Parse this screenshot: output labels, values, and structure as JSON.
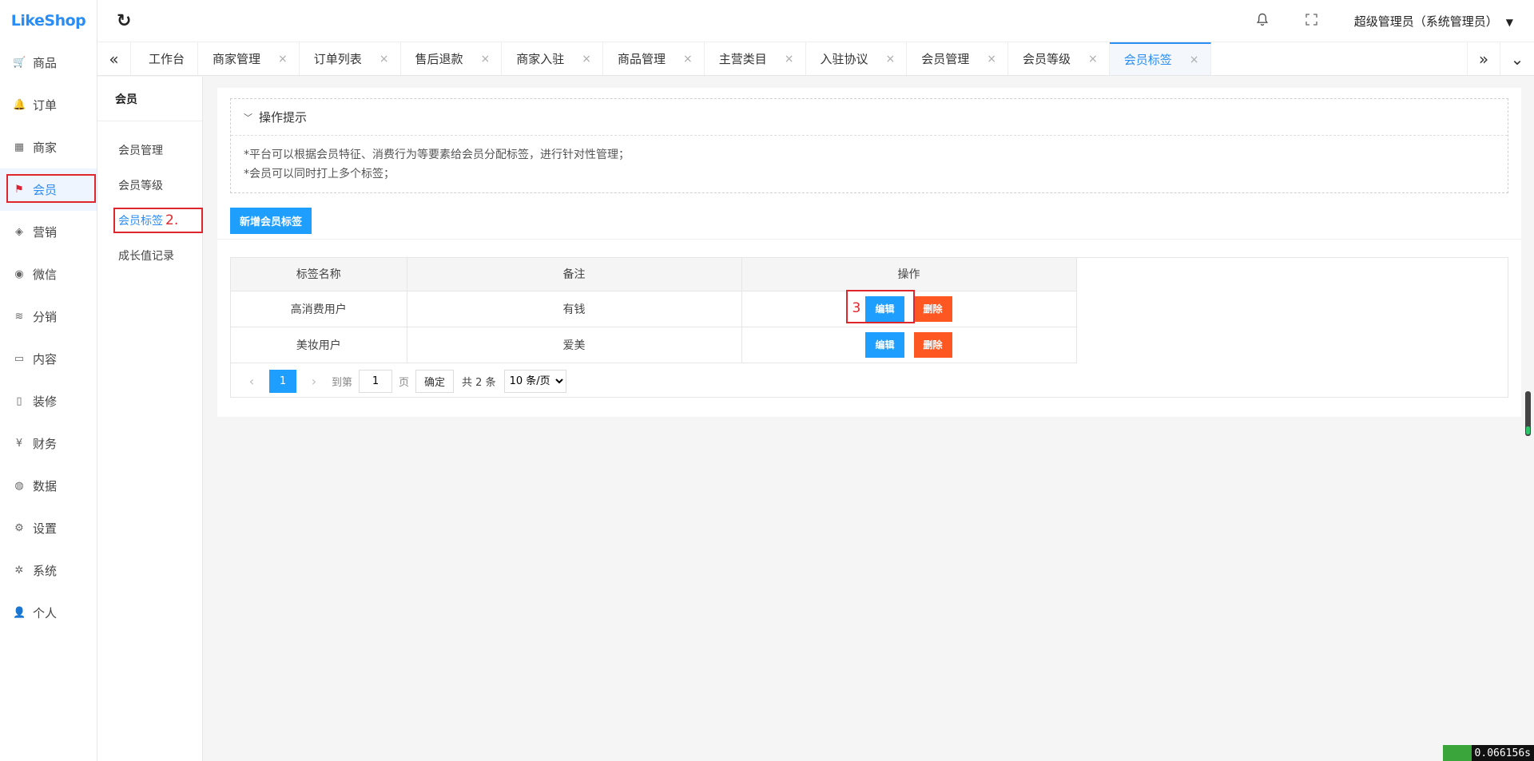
{
  "brand": {
    "logo_text": "LikeShop"
  },
  "header": {
    "refresh_icon": "↻",
    "bell_icon": "bell-icon",
    "fullscreen_icon": "fullscreen-icon",
    "user_name": "超级管理员（系统管理员）"
  },
  "sidebar": {
    "items": [
      {
        "label": "商品",
        "icon": "🛒"
      },
      {
        "label": "订单",
        "icon": "🔔"
      },
      {
        "label": "商家",
        "icon": "▦"
      },
      {
        "label": "会员",
        "icon": "⚑"
      },
      {
        "label": "营销",
        "icon": "◈"
      },
      {
        "label": "微信",
        "icon": "◉"
      },
      {
        "label": "分销",
        "icon": "≋"
      },
      {
        "label": "内容",
        "icon": "▭"
      },
      {
        "label": "装修",
        "icon": "▯"
      },
      {
        "label": "财务",
        "icon": "¥"
      },
      {
        "label": "数据",
        "icon": "◍"
      },
      {
        "label": "设置",
        "icon": "⚙"
      },
      {
        "label": "系统",
        "icon": "✲"
      },
      {
        "label": "个人",
        "icon": "👤"
      }
    ]
  },
  "tabs": [
    {
      "label": "工作台"
    },
    {
      "label": "商家管理"
    },
    {
      "label": "订单列表"
    },
    {
      "label": "售后退款"
    },
    {
      "label": "商家入驻"
    },
    {
      "label": "商品管理"
    },
    {
      "label": "主营类目"
    },
    {
      "label": "入驻协议"
    },
    {
      "label": "会员管理"
    },
    {
      "label": "会员等级"
    },
    {
      "label": "会员标签"
    }
  ],
  "tab_close_glyph": "×",
  "subnav": {
    "title": "会员",
    "items": [
      {
        "label": "会员管理"
      },
      {
        "label": "会员等级"
      },
      {
        "label": "会员标签"
      },
      {
        "label": "成长值记录"
      }
    ],
    "step_label": "2."
  },
  "tips": {
    "title": "操作提示",
    "lines": [
      "*平台可以根据会员特征、消费行为等要素给会员分配标签，进行针对性管理；",
      "*会员可以同时打上多个标签；"
    ]
  },
  "add_button": "新增会员标签",
  "table": {
    "headers": [
      "标签名称",
      "备注",
      "操作"
    ],
    "rows": [
      {
        "name": "高消费用户",
        "remark": "有钱"
      },
      {
        "name": "美妆用户",
        "remark": "爱美"
      }
    ],
    "edit_label": "编辑",
    "delete_label": "删除",
    "step_label": "3"
  },
  "pager": {
    "current": "1",
    "goto_label": "到第",
    "goto_value": "1",
    "page_label": "页",
    "confirm_label": "确定",
    "total": "共 2 条",
    "page_size": "10 条/页"
  },
  "timer": "0.066156s"
}
